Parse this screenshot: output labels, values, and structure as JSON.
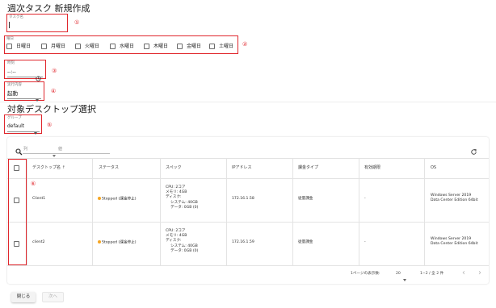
{
  "page": {
    "title": "週次タスク 新規作成",
    "section2_title": "対象デスクトップ選択"
  },
  "task_name": {
    "label": "タスク名",
    "value": ""
  },
  "weekday": {
    "label": "曜日",
    "days": [
      "日曜日",
      "月曜日",
      "火曜日",
      "水曜日",
      "木曜日",
      "金曜日",
      "土曜日"
    ]
  },
  "time": {
    "label": "時刻",
    "value": "--:--"
  },
  "action": {
    "label": "実行内容",
    "value": "起動"
  },
  "group": {
    "label": "グループ",
    "value": "default"
  },
  "filter": {
    "column_placeholder": "列",
    "value_placeholder": "値"
  },
  "annotations": [
    "①",
    "②",
    "③",
    "④",
    "⑤",
    "⑥"
  ],
  "table": {
    "columns": [
      "デスクトップ名",
      "ステータス",
      "スペック",
      "IPアドレス",
      "課金タイプ",
      "有効期限",
      "OS"
    ],
    "sort_indicator": "↑",
    "rows": [
      {
        "name": "Client1",
        "status": "Stopped (課金停止)",
        "spec": [
          "CPU: 2コア",
          "メモリ: 4GB",
          "ディスク:",
          "システム: 40GB",
          "データ: 0GB (0)"
        ],
        "ip": "172.16.1.58",
        "billing": "従量課金",
        "expiry": "-",
        "os": [
          "Windows Server 2019",
          "Data Center Edition 64bit"
        ]
      },
      {
        "name": "client2",
        "status": "Stopped (課金停止)",
        "spec": [
          "CPU: 2コア",
          "メモリ: 4GB",
          "ディスク:",
          "システム: 40GB",
          "データ: 0GB (0)"
        ],
        "ip": "172.16.1.59",
        "billing": "従量課金",
        "expiry": "-",
        "os": [
          "Windows Server 2019",
          "Data Center Edition 64bit"
        ]
      }
    ]
  },
  "pagination": {
    "rows_per_page_label": "1ページの表示数:",
    "rows_per_page": "20",
    "range": "1−2 / 全 2 件",
    "prev": "‹",
    "next": "›"
  },
  "buttons": {
    "close": "閉じる",
    "next": "次へ"
  },
  "icons": {
    "search": "search-icon",
    "refresh": "refresh-icon",
    "clock": "clock-icon"
  },
  "colors": {
    "annotation": "#e0262c",
    "status_stopped": "#f5a623"
  }
}
